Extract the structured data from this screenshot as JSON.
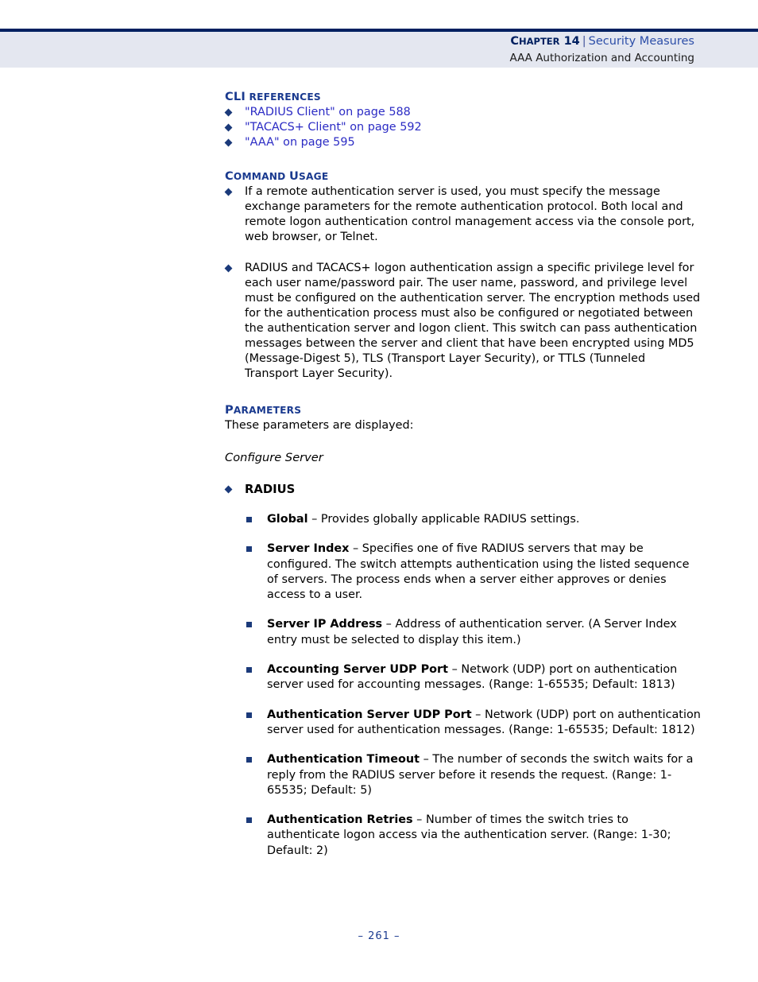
{
  "header": {
    "chapter_label": "C",
    "chapter_label_rest": "HAPTER",
    "chapter_number": "14",
    "separator": "|",
    "section_title": "Security Measures",
    "subtitle": "AAA Authorization and Accounting"
  },
  "sections": {
    "cli_references": {
      "heading_cap": "CLI",
      "heading_rest": "REFERENCES",
      "items": [
        "\"RADIUS Client\" on page 588",
        "\"TACACS+ Client\" on page 592",
        "\"AAA\" on page 595"
      ]
    },
    "command_usage": {
      "heading_cap": "C",
      "heading_rest": "OMMAND",
      "heading_cap2": "U",
      "heading_rest2": "SAGE",
      "items": [
        "If a remote authentication server is used, you must specify the message exchange parameters for the remote authentication protocol. Both local and remote logon authentication control management access via the console port, web browser, or Telnet.",
        "RADIUS and TACACS+ logon authentication assign a specific privilege level for each user name/password pair. The user name, password, and privilege level must be configured on the authentication server. The encryption methods used for the authentication process must also be configured or negotiated between the authentication server and logon client. This switch can pass authentication messages between the server and client that have been encrypted using MD5 (Message-Digest 5), TLS (Transport Layer Security), or TTLS (Tunneled Transport Layer Security)."
      ]
    },
    "parameters": {
      "heading_cap": "P",
      "heading_rest": "ARAMETERS",
      "intro": "These parameters are displayed:",
      "subsection_title": "Configure Server",
      "group_label": "RADIUS",
      "entries": [
        {
          "term": "Global",
          "description": " – Provides globally applicable RADIUS settings."
        },
        {
          "term": "Server Index",
          "description": " – Specifies one of five RADIUS servers that may be configured. The switch attempts authentication using the listed sequence of servers. The process ends when a server either approves or denies access to a user."
        },
        {
          "term": "Server IP Address",
          "description": " – Address of authentication server. (A Server Index entry must be selected to display this item.)"
        },
        {
          "term": "Accounting Server UDP Port",
          "description": " – Network (UDP) port on authentication server used for accounting messages. (Range: 1-65535; Default: 1813)"
        },
        {
          "term": "Authentication Server UDP Port",
          "description": " – Network (UDP) port on authentication server used for authentication messages. (Range: 1-65535; Default: 1812)"
        },
        {
          "term": "Authentication Timeout",
          "description": " – The number of seconds the switch waits for a reply from the RADIUS server before it resends the request. (Range: 1-65535; Default: 5)"
        },
        {
          "term": "Authentication Retries",
          "description": " – Number of times the switch tries to authenticate logon access via the authentication server. (Range: 1-30; Default: 2)"
        }
      ]
    }
  },
  "footer": {
    "page_number": "–  261  –"
  }
}
